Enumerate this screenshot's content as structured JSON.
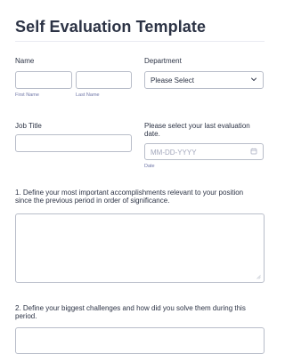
{
  "form": {
    "title": "Self Evaluation Template"
  },
  "name": {
    "label": "Name",
    "first_sublabel": "First Name",
    "last_sublabel": "Last Name",
    "first_value": "",
    "last_value": ""
  },
  "department": {
    "label": "Department",
    "selected": "Please Select"
  },
  "job_title": {
    "label": "Job Title",
    "value": ""
  },
  "evaluation_date": {
    "label_line1": "Please select your last evaluation",
    "label_line2": "date.",
    "placeholder": "MM-DD-YYYY",
    "sublabel": "Date"
  },
  "question1": {
    "label_line1": "1. Define your most important accomplishments relevant to your position",
    "label_line2": "since the previous period in order of significance.",
    "value": ""
  },
  "question2": {
    "label_line1": "2. Define your biggest challenges and how did you solve them during this",
    "label_line2": "period.",
    "value": ""
  },
  "icons": {
    "department_dropdown": "chevron-down-icon",
    "date_picker": "calendar-icon",
    "textarea_resize": "resize-handle-icon"
  },
  "colors": {
    "text": "#2c3345",
    "border": "#b8bdc9",
    "sublabel": "#6f76a7",
    "placeholder": "#a3a8bc"
  }
}
